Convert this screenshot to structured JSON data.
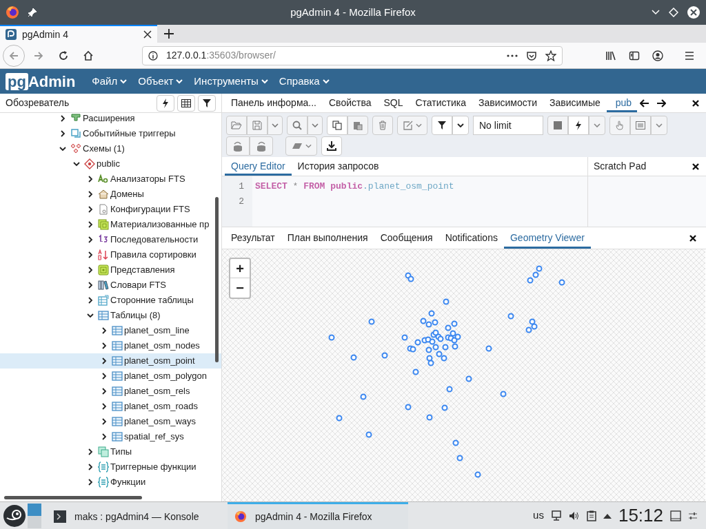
{
  "window": {
    "title": "pgAdmin 4 - Mozilla Firefox"
  },
  "browser": {
    "tabs": [
      {
        "label": "pgAdmin 4",
        "selected": true
      }
    ],
    "url_host": "127.0.0.1",
    "url_rest": ":35603/browser/"
  },
  "app": {
    "logo": "pgAdmin",
    "menu": [
      {
        "label": "Файл"
      },
      {
        "label": "Объект"
      },
      {
        "label": "Инструменты"
      },
      {
        "label": "Справка"
      }
    ]
  },
  "sidebar": {
    "title": "Обозреватель",
    "tree": [
      {
        "label": "Расширения",
        "kind": "extension",
        "expanded": false,
        "selected": false
      },
      {
        "label": "Событийные триггеры",
        "kind": "event-trigger",
        "expanded": false,
        "selected": false
      },
      {
        "label": "Схемы (1)",
        "kind": "schemas",
        "expanded": true,
        "selected": false,
        "children": [
          {
            "label": "public",
            "kind": "schema",
            "expanded": true,
            "selected": false,
            "children": [
              {
                "label": "Анализаторы FTS",
                "kind": "fts-parser",
                "expanded": false,
                "selected": false
              },
              {
                "label": "Домены",
                "kind": "domain",
                "expanded": false,
                "selected": false
              },
              {
                "label": "Конфигурации FTS",
                "kind": "fts-config",
                "expanded": false,
                "selected": false
              },
              {
                "label": "Материализованные пр",
                "kind": "mview",
                "expanded": false,
                "selected": false
              },
              {
                "label": "Последовательности",
                "kind": "sequence",
                "expanded": false,
                "selected": false
              },
              {
                "label": "Правила сортировки",
                "kind": "collation",
                "expanded": false,
                "selected": false
              },
              {
                "label": "Представления",
                "kind": "view",
                "expanded": false,
                "selected": false
              },
              {
                "label": "Словари FTS",
                "kind": "fts-dict",
                "expanded": false,
                "selected": false
              },
              {
                "label": "Сторонние таблицы",
                "kind": "foreign-table",
                "expanded": false,
                "selected": false
              },
              {
                "label": "Таблицы (8)",
                "kind": "table",
                "expanded": true,
                "selected": false,
                "children": [
                  {
                    "label": "planet_osm_line",
                    "kind": "table",
                    "expanded": false,
                    "selected": false
                  },
                  {
                    "label": "planet_osm_nodes",
                    "kind": "table",
                    "expanded": false,
                    "selected": false
                  },
                  {
                    "label": "planet_osm_point",
                    "kind": "table",
                    "expanded": false,
                    "selected": true
                  },
                  {
                    "label": "planet_osm_polygon",
                    "kind": "table",
                    "expanded": false,
                    "selected": false
                  },
                  {
                    "label": "planet_osm_rels",
                    "kind": "table",
                    "expanded": false,
                    "selected": false
                  },
                  {
                    "label": "planet_osm_roads",
                    "kind": "table",
                    "expanded": false,
                    "selected": false
                  },
                  {
                    "label": "planet_osm_ways",
                    "kind": "table",
                    "expanded": false,
                    "selected": false
                  },
                  {
                    "label": "spatial_ref_sys",
                    "kind": "table",
                    "expanded": false,
                    "selected": false
                  }
                ]
              },
              {
                "label": "Типы",
                "kind": "type",
                "expanded": false,
                "selected": false
              },
              {
                "label": "Триггерные функции",
                "kind": "function",
                "expanded": false,
                "selected": false
              },
              {
                "label": "Функции",
                "kind": "function",
                "expanded": false,
                "selected": false
              }
            ]
          }
        ]
      }
    ]
  },
  "panel_tabs": [
    {
      "label": "Панель информа...",
      "selected": false
    },
    {
      "label": "Свойства",
      "selected": false
    },
    {
      "label": "SQL",
      "selected": false
    },
    {
      "label": "Статистика",
      "selected": false
    },
    {
      "label": "Зависимости",
      "selected": false
    },
    {
      "label": "Зависимые",
      "selected": false
    },
    {
      "label": "pub",
      "selected": true
    }
  ],
  "toolbar": {
    "limit": "No limit"
  },
  "editor_tabs": [
    {
      "label": "Query Editor",
      "selected": true
    },
    {
      "label": "История запросов",
      "selected": false
    }
  ],
  "scratch_pad": {
    "title": "Scratch Pad"
  },
  "editor": {
    "lines": [
      {
        "number": "1",
        "tokens": [
          {
            "text": "SELECT",
            "kind": "keyword"
          },
          {
            "text": " * ",
            "kind": "operator"
          },
          {
            "text": "FROM",
            "kind": "keyword"
          },
          {
            "text": " public",
            "kind": "keyword"
          },
          {
            "text": ".planet_osm_point",
            "kind": "identifier"
          }
        ]
      },
      {
        "number": "2"
      }
    ]
  },
  "result_tabs": [
    {
      "label": "Результат",
      "selected": false
    },
    {
      "label": "План выполнения",
      "selected": false
    },
    {
      "label": "Сообщения",
      "selected": false
    },
    {
      "label": "Notifications",
      "selected": false
    },
    {
      "label": "Geometry Viewer",
      "selected": true
    }
  ],
  "map": {
    "zoom_in": "+",
    "zoom_out": "−"
  },
  "taskbar": {
    "tasks": [
      {
        "label": "maks : pgAdmin4 — Konsole",
        "kind": "terminal",
        "selected": false
      },
      {
        "label": "pgAdmin 4 - Mozilla Firefox",
        "kind": "browser",
        "selected": true
      }
    ],
    "keyboard": "us",
    "clock": "15:12"
  }
}
